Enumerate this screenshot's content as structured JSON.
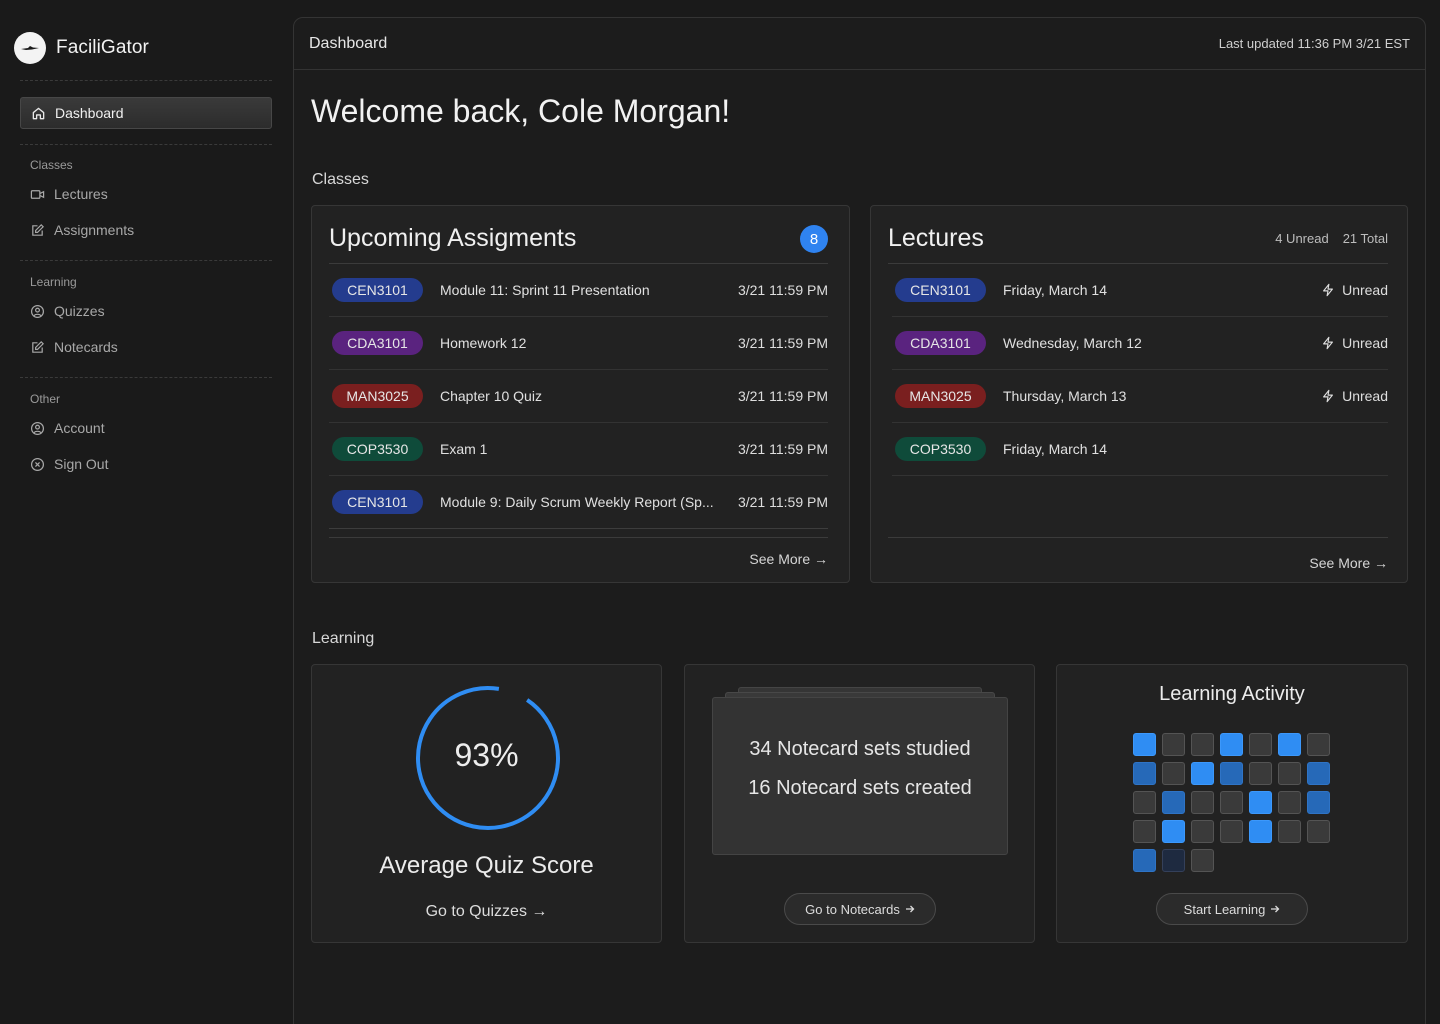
{
  "app": {
    "name": "FaciliGator"
  },
  "sidebar": {
    "active": {
      "label": "Dashboard",
      "icon": "home-icon"
    },
    "sections": [
      {
        "label": "Classes",
        "items": [
          {
            "label": "Lectures",
            "icon": "video-icon"
          },
          {
            "label": "Assignments",
            "icon": "edit-icon"
          }
        ]
      },
      {
        "label": "Learning",
        "items": [
          {
            "label": "Quizzes",
            "icon": "quiz-icon"
          },
          {
            "label": "Notecards",
            "icon": "edit-icon"
          }
        ]
      },
      {
        "label": "Other",
        "items": [
          {
            "label": "Account",
            "icon": "user-icon"
          },
          {
            "label": "Sign Out",
            "icon": "close-circle-icon"
          }
        ]
      }
    ]
  },
  "header": {
    "title": "Dashboard",
    "last_updated": "Last updated 11:36 PM 3/21 EST"
  },
  "welcome": "Welcome back, Cole Morgan!",
  "classes_section": {
    "label": "Classes"
  },
  "assignments": {
    "title": "Upcoming Assigments",
    "count": "8",
    "see_more": "See More →",
    "rows": [
      {
        "course": "CEN3101",
        "name": "Module 11: Sprint 11 Presentation",
        "due": "3/21 11:59 PM"
      },
      {
        "course": "CDA3101",
        "name": "Homework 12",
        "due": "3/21 11:59 PM"
      },
      {
        "course": "MAN3025",
        "name": "Chapter 10 Quiz",
        "due": "3/21 11:59 PM"
      },
      {
        "course": "COP3530",
        "name": "Exam 1",
        "due": "3/21 11:59 PM"
      },
      {
        "course": "CEN3101",
        "name": "Module 9: Daily Scrum Weekly Report (Sp...",
        "due": "3/21 11:59 PM"
      }
    ]
  },
  "lectures": {
    "title": "Lectures",
    "unread": "4 Unread",
    "total": "21 Total",
    "see_more": "See More →",
    "rows": [
      {
        "course": "CEN3101",
        "date": "Friday,  March 14",
        "status": "Unread"
      },
      {
        "course": "CDA3101",
        "date": "Wednesday, March 12",
        "status": "Unread"
      },
      {
        "course": "MAN3025",
        "date": "Thursday, March 13",
        "status": "Unread"
      },
      {
        "course": "COP3530",
        "date": "Friday, March 14",
        "status": ""
      }
    ]
  },
  "course_colors": {
    "CEN3101": "#243c8e",
    "CDA3101": "#5a237f",
    "MAN3025": "#7a1f1f",
    "COP3530": "#0f4b3a"
  },
  "learning_section": {
    "label": "Learning"
  },
  "quiz": {
    "score_fraction": 0.93,
    "score_text": "93%",
    "label": "Average Quiz Score",
    "link": "Go to Quizzes →",
    "ring_color": "#2f8df3"
  },
  "notecards": {
    "studied": "34 Notecard sets studied",
    "created": "16 Notecard sets created",
    "button": "Go to Notecards"
  },
  "activity": {
    "title": "Learning Activity",
    "button": "Start Learning",
    "levels": [
      3,
      1,
      1,
      3,
      1,
      3,
      1,
      2,
      1,
      3,
      2,
      1,
      1,
      2,
      1,
      2,
      1,
      1,
      3,
      1,
      2,
      1,
      3,
      1,
      1,
      3,
      1,
      1,
      2,
      4,
      1
    ]
  }
}
